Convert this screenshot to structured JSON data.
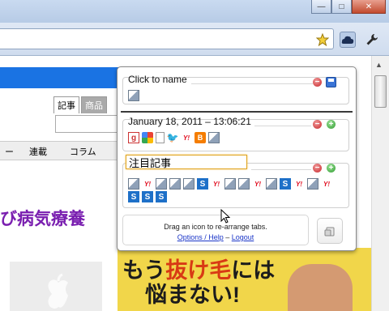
{
  "window": {
    "minimize_symbol": "—",
    "maximize_symbol": "□",
    "close_symbol": "✕"
  },
  "toolbar": {
    "icons": [
      "star-icon",
      "cloud-extension-icon",
      "wrench-icon"
    ]
  },
  "page": {
    "search_tab_articles": "記事",
    "search_tab_products": "商品",
    "nav_items": [
      "ー",
      "連載",
      "コラム"
    ],
    "headline": "び病気療養",
    "ad_line1_pre": "もう",
    "ad_line1_highlight": "抜け毛",
    "ad_line1_post": "には",
    "ad_line2": "悩まない!"
  },
  "popup": {
    "group1": {
      "name": "Click to name",
      "icons": [
        "gray"
      ]
    },
    "group2": {
      "name": "January 18, 2011 – 13:06:21",
      "icons": [
        "g",
        "google",
        "doc",
        "twitter",
        "yahoo",
        "blogger",
        "gray"
      ]
    },
    "group3": {
      "name_value": "注目記事",
      "icons": [
        "gray",
        "yahoo",
        "gray",
        "gray",
        "gray",
        "s",
        "yahoo",
        "gray",
        "gray",
        "yahoo",
        "gray",
        "s",
        "yahoo",
        "gray",
        "yahoo",
        "s",
        "s",
        "s"
      ]
    },
    "help": {
      "line1": "Drag an icon to re-arrange tabs.",
      "options_link": "Options / Help",
      "dash": " – ",
      "logout_link": "Logout"
    }
  },
  "colors": {
    "accent_blue": "#1a73e3",
    "headline_purple": "#7a1fb0",
    "minus_red": "#c8262a",
    "plus_green": "#2e9a2e",
    "input_focus": "#e0a520"
  }
}
